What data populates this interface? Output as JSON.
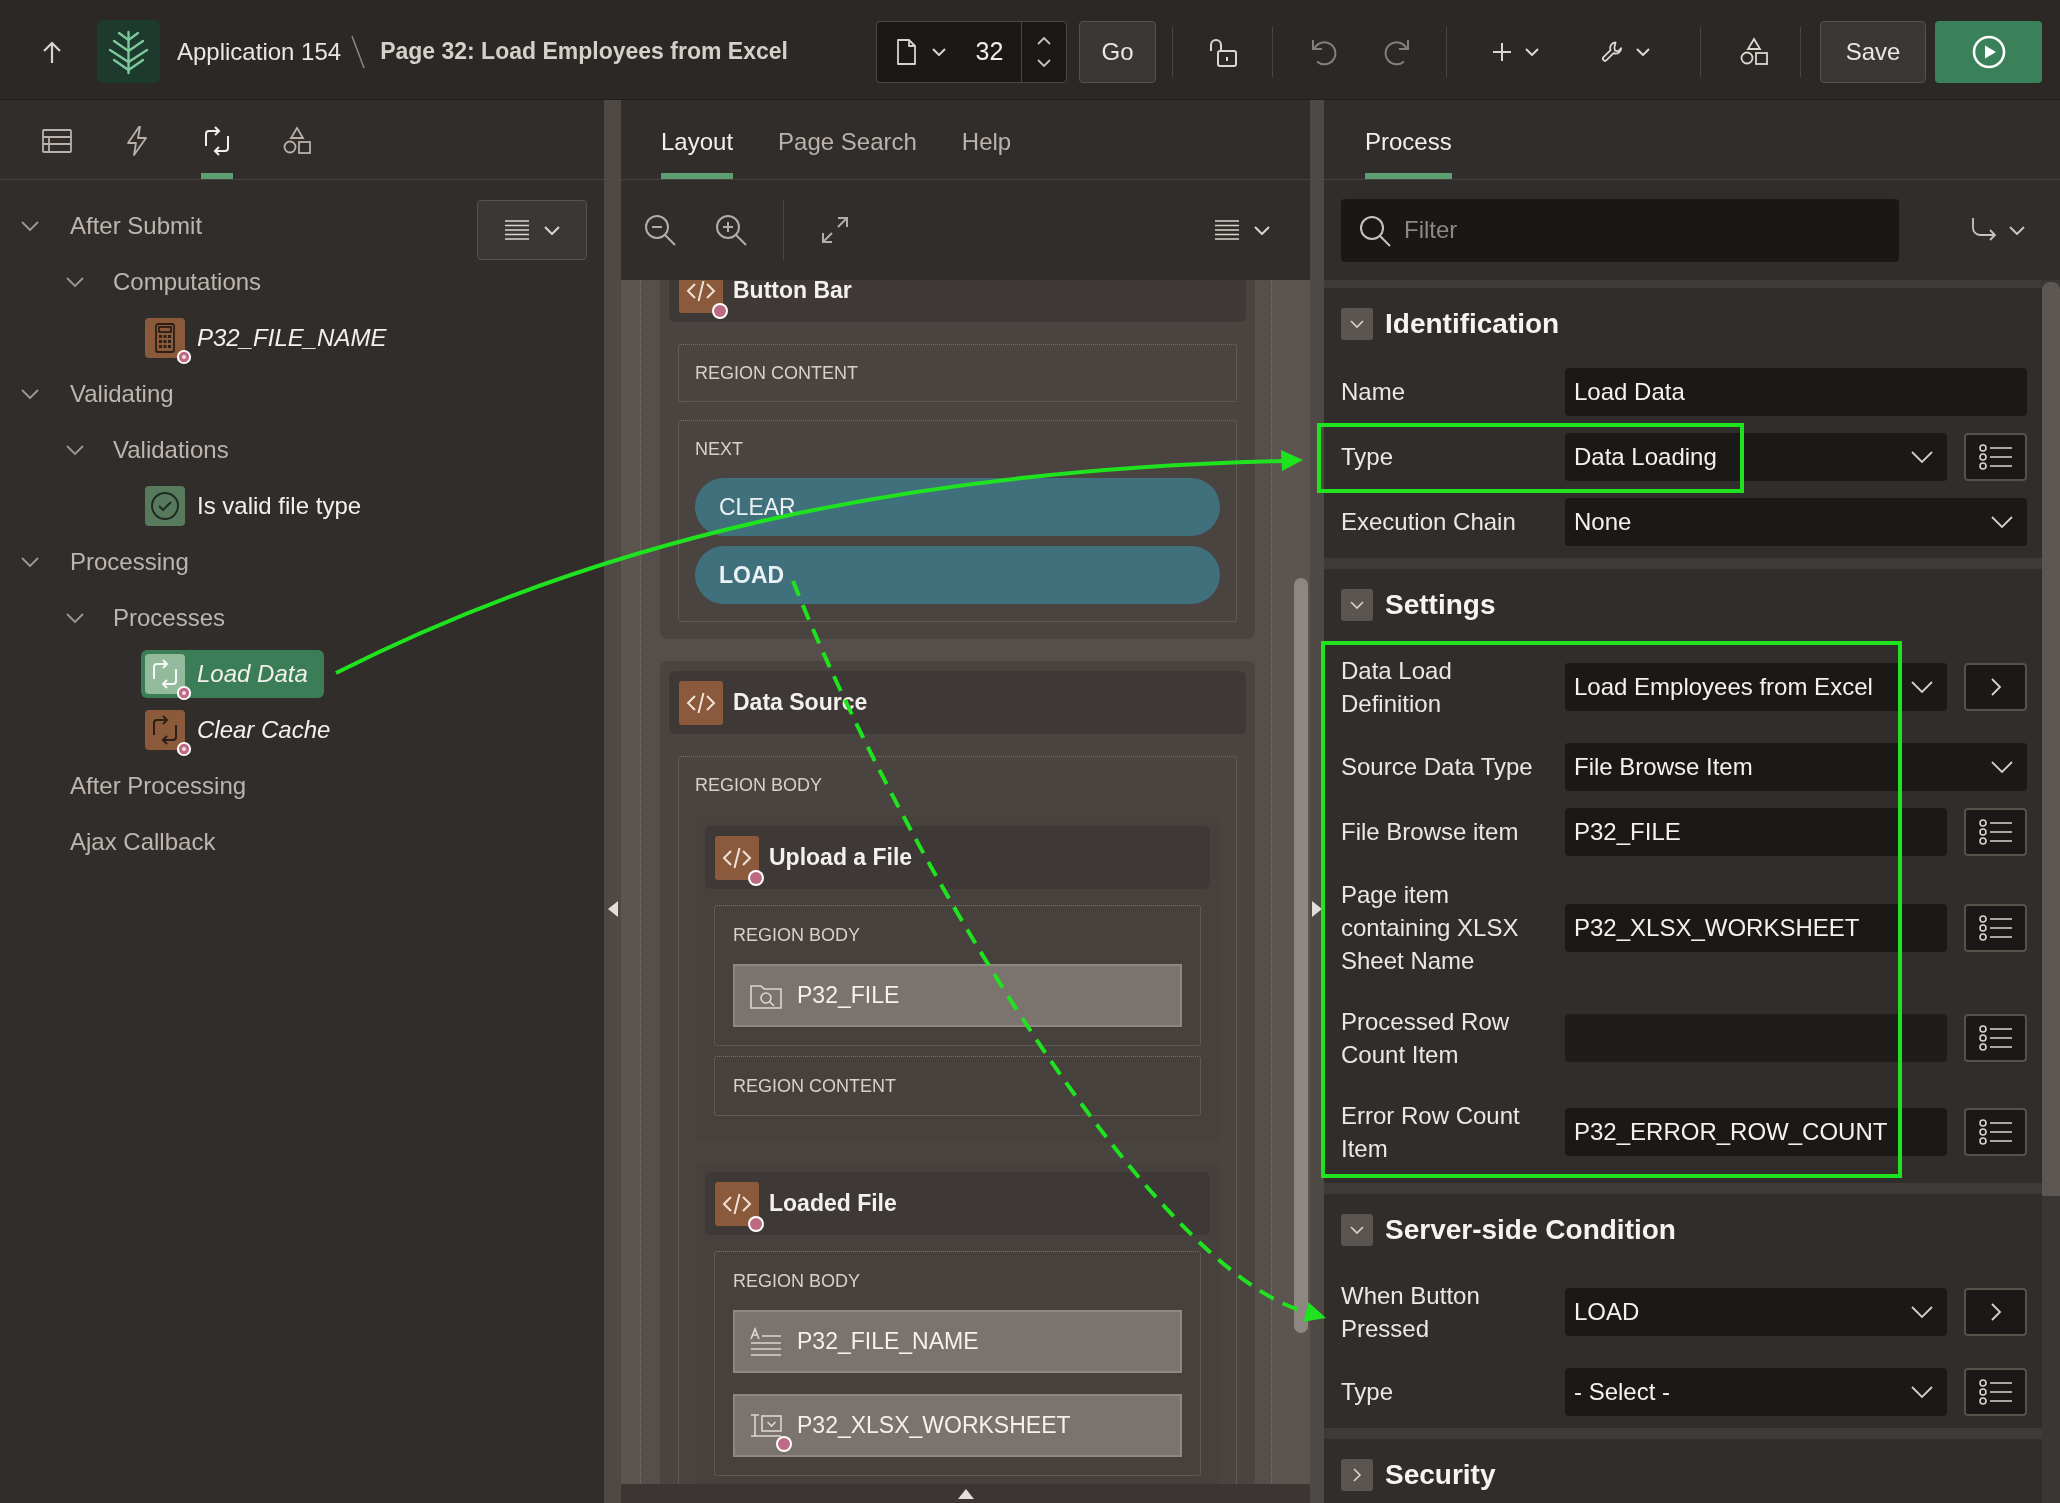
{
  "header": {
    "app_link": "Application 154",
    "page_title": "Page 32: Load Employees from Excel",
    "page_number": "32",
    "go_button": "Go",
    "undo": {
      "disabled": true
    },
    "redo": {
      "disabled": true
    },
    "save_button": "Save"
  },
  "left_panel": {
    "tabs": [
      {
        "kind": "rendering",
        "selected": false
      },
      {
        "kind": "dynamic_actions",
        "selected": false
      },
      {
        "kind": "processing",
        "selected": true
      },
      {
        "kind": "shared_components",
        "selected": false
      }
    ],
    "tree": [
      {
        "label": "After Submit",
        "expanded": true,
        "children": [
          {
            "label": "Computations",
            "expanded": true,
            "children": [
              {
                "label": "P32_FILE_NAME",
                "kind": "computation",
                "conditional": true,
                "selected": false
              }
            ]
          }
        ]
      },
      {
        "label": "Validating",
        "expanded": true,
        "children": [
          {
            "label": "Validations",
            "expanded": true,
            "children": [
              {
                "label": "Is valid file type",
                "kind": "validation",
                "conditional": false,
                "selected": false
              }
            ]
          }
        ]
      },
      {
        "label": "Processing",
        "expanded": true,
        "children": [
          {
            "label": "Processes",
            "expanded": true,
            "children": [
              {
                "label": "Load Data",
                "kind": "process",
                "conditional": true,
                "selected": true
              },
              {
                "label": "Clear Cache",
                "kind": "process",
                "conditional": true,
                "selected": false
              }
            ]
          }
        ]
      },
      {
        "label": "After Processing"
      },
      {
        "label": "Ajax Callback"
      }
    ]
  },
  "layout_panel": {
    "tabs": [
      {
        "label": "Layout",
        "selected": true
      },
      {
        "label": "Page Search",
        "selected": false
      },
      {
        "label": "Help",
        "selected": false
      }
    ],
    "regions": [
      {
        "title": "Button Bar",
        "conditional": true,
        "slots": [
          {
            "label": "REGION CONTENT"
          },
          {
            "label": "NEXT",
            "buttons": [
              {
                "label": "CLEAR",
                "hot": false
              },
              {
                "label": "LOAD",
                "hot": true
              }
            ]
          }
        ]
      },
      {
        "title": "Data Source",
        "conditional": false,
        "slots": [
          {
            "label": "REGION BODY",
            "regions": [
              {
                "title": "Upload a File",
                "conditional": true,
                "slots": [
                  {
                    "label": "REGION BODY",
                    "items": [
                      {
                        "name": "P32_FILE",
                        "kind": "file_browse",
                        "conditional": false
                      }
                    ]
                  },
                  {
                    "label": "REGION CONTENT"
                  }
                ]
              },
              {
                "title": "Loaded File",
                "conditional": true,
                "slots": [
                  {
                    "label": "REGION BODY",
                    "items": [
                      {
                        "name": "P32_FILE_NAME",
                        "kind": "display_only",
                        "conditional": false
                      },
                      {
                        "name": "P32_XLSX_WORKSHEET",
                        "kind": "select_list",
                        "conditional": true
                      }
                    ]
                  }
                ]
              }
            ]
          }
        ]
      }
    ]
  },
  "property_panel": {
    "tabs": [
      {
        "label": "Process",
        "selected": true
      }
    ],
    "filter": {
      "placeholder": "Filter"
    },
    "sections": [
      {
        "title": "Identification",
        "expanded": true,
        "rows": [
          {
            "label": "Name",
            "kind": "text",
            "value": "Load Data"
          },
          {
            "label": "Type",
            "kind": "select",
            "value": "Data Loading",
            "button": {
              "kind": "list"
            }
          },
          {
            "label": "Execution Chain",
            "kind": "select",
            "value": "None"
          }
        ]
      },
      {
        "title": "Settings",
        "expanded": true,
        "rows": [
          {
            "label": "Data Load Definition",
            "kind": "select",
            "value": "Load Employees from Excel",
            "button": {
              "kind": "link"
            }
          },
          {
            "label": "Source Data Type",
            "kind": "select",
            "value": "File Browse Item"
          },
          {
            "label": "File Browse item",
            "kind": "text",
            "value": "P32_FILE",
            "button": {
              "kind": "list"
            }
          },
          {
            "label": "Page item containing XLSX Sheet Name",
            "kind": "text",
            "value": "P32_XLSX_WORKSHEET",
            "button": {
              "kind": "list"
            }
          },
          {
            "label": "Processed Row Count Item",
            "kind": "text",
            "button": {
              "kind": "list"
            }
          },
          {
            "label": "Error Row Count Item",
            "kind": "text",
            "value": "P32_ERROR_ROW_COUNT",
            "button": {
              "kind": "list"
            }
          }
        ]
      },
      {
        "title": "Server-side Condition",
        "expanded": true,
        "rows": [
          {
            "label": "When Button Pressed",
            "kind": "select",
            "value": "LOAD",
            "button": {
              "kind": "link"
            }
          },
          {
            "label": "Type",
            "kind": "select",
            "value": "- Select -",
            "button": {
              "kind": "list"
            }
          }
        ]
      },
      {
        "title": "Security",
        "expanded": false
      }
    ]
  }
}
